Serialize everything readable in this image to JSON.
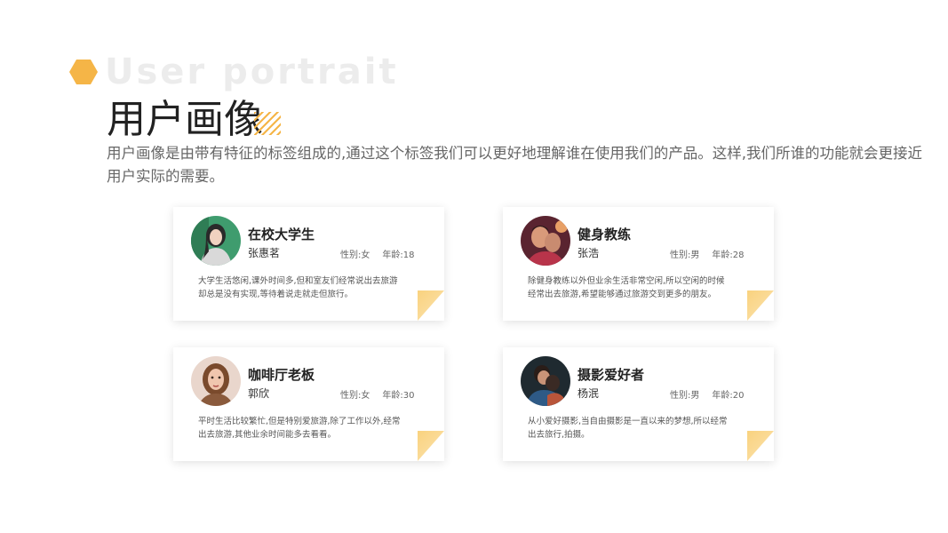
{
  "header": {
    "title_en": "User portrait",
    "title_cn": "用户画像",
    "description": "用户画像是由带有特征的标签组成的,通过这个标签我们可以更好地理解谁在使用我们的产品。这样,我们所谁的功能就会更接近用户实际的需要。"
  },
  "cards": [
    {
      "role": "在校大学生",
      "name": "张惠茗",
      "gender": "性别:女",
      "age": "年龄:18",
      "bio": "大学生活悠闲,课外时间多,但和室友们经常说出去旅游却总是没有实现,等待着说走就走但旅行。"
    },
    {
      "role": "健身教练",
      "name": "张浩",
      "gender": "性别:男",
      "age": "年龄:28",
      "bio": "除健身教练以外但业余生活非常空闲,所以空闲的时候经常出去旅游,希望能够通过旅游交到更多的朋友。"
    },
    {
      "role": "咖啡厅老板",
      "name": "郭欣",
      "gender": "性别:女",
      "age": "年龄:30",
      "bio": "平时生活比较繁忙,但是特别爱旅游,除了工作以外,经常出去旅游,其他业余时间能多去看看。"
    },
    {
      "role": "摄影爱好者",
      "name": "杨泯",
      "gender": "性别:男",
      "age": "年龄:20",
      "bio": "从小爱好摄影,当自由摄影是一直以来的梦想,所以经常出去旅行,拍摄。"
    }
  ],
  "colors": {
    "accent": "#f5b547",
    "fold": "#f9d27e"
  }
}
